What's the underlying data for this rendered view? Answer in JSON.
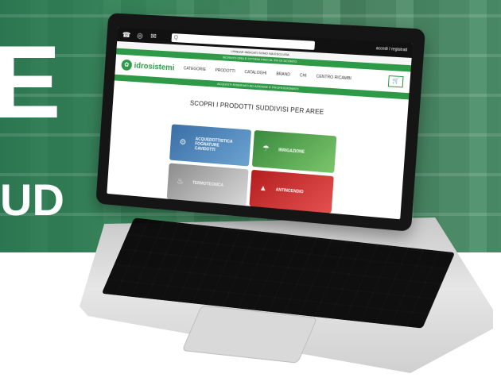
{
  "banner": {
    "big_letter": "E",
    "side_text": "UD"
  },
  "site": {
    "topbar_icons": [
      "phone-icon",
      "whatsapp-icon",
      "mail-icon"
    ],
    "search_placeholder": "Q",
    "account": "accedi / registrati",
    "promo": "I PREZZI INDICATI SONO IVA ESCLUSA",
    "green_strip": "ISCRIVITI ORA E OTTIENI FINO AL 5% DI SCONTO",
    "logo": "idrosistemi",
    "nav_items": [
      "CATEGORIE",
      "PRODOTTI",
      "CATALOGHI",
      "BRAND",
      "CHI",
      "CENTRO RICAMBI"
    ],
    "notice": "ACQUISTI RISERVATI AD AZIENDE E PROFESSIONISTI",
    "section_heading": "SCOPRI I PRODOTTI SUDDIVISI PER AREE",
    "tiles": [
      {
        "label": "ACQUEDOTTISTICA\nFOGNATURE\nCAVIDOTTI",
        "icon": "pipe-icon"
      },
      {
        "label": "IRRIGAZIONE",
        "icon": "sprinkler-icon"
      },
      {
        "label": "TERMOTECNICA",
        "icon": "thermo-icon"
      },
      {
        "label": "ANTINCENDIO",
        "icon": "fire-icon"
      }
    ],
    "colors": {
      "brand_green": "#2e9947"
    }
  }
}
